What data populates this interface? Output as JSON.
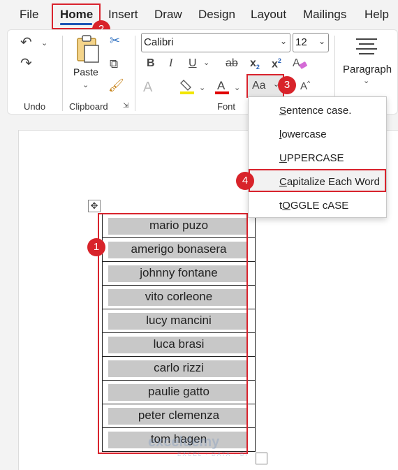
{
  "menu": {
    "tabs": [
      "File",
      "Home",
      "Insert",
      "Draw",
      "Design",
      "Layout",
      "Mailings",
      "Help"
    ],
    "active_tab": "Home"
  },
  "ribbon": {
    "undo_group_label": "Undo",
    "clipboard_group_label": "Clipboard",
    "paste_label": "Paste",
    "font_group_label": "Font",
    "font_name": "Calibri",
    "font_size": "12",
    "change_case_label": "Aa",
    "paragraph_label": "Paragraph"
  },
  "change_case_menu": {
    "items": [
      {
        "prefix": "",
        "accel": "S",
        "rest": "entence case."
      },
      {
        "prefix": "",
        "accel": "l",
        "rest": "owercase"
      },
      {
        "prefix": "",
        "accel": "U",
        "rest": "PPERCASE"
      },
      {
        "prefix": "",
        "accel": "C",
        "rest": "apitalize Each Word"
      },
      {
        "prefix": "t",
        "accel": "O",
        "rest": "GGLE cASE"
      }
    ]
  },
  "markers": [
    "1",
    "2",
    "3",
    "4"
  ],
  "table": {
    "rows": [
      "mario puzo",
      "amerigo bonasera",
      "johnny fontane",
      "vito corleone",
      "lucy mancini",
      "luca brasi",
      "carlo rizzi",
      "paulie gatto",
      "peter clemenza",
      "tom hagen"
    ]
  },
  "watermark": {
    "text": "exceldemy",
    "sub": "EXCEL · DATA · BI"
  },
  "colors": {
    "accent_red": "#d9232d",
    "active_tab_underline": "#1d55b4",
    "highlight_yellow": "#f2e600",
    "font_color_red": "#e00000",
    "cell_fill": "#c8c8c8"
  }
}
